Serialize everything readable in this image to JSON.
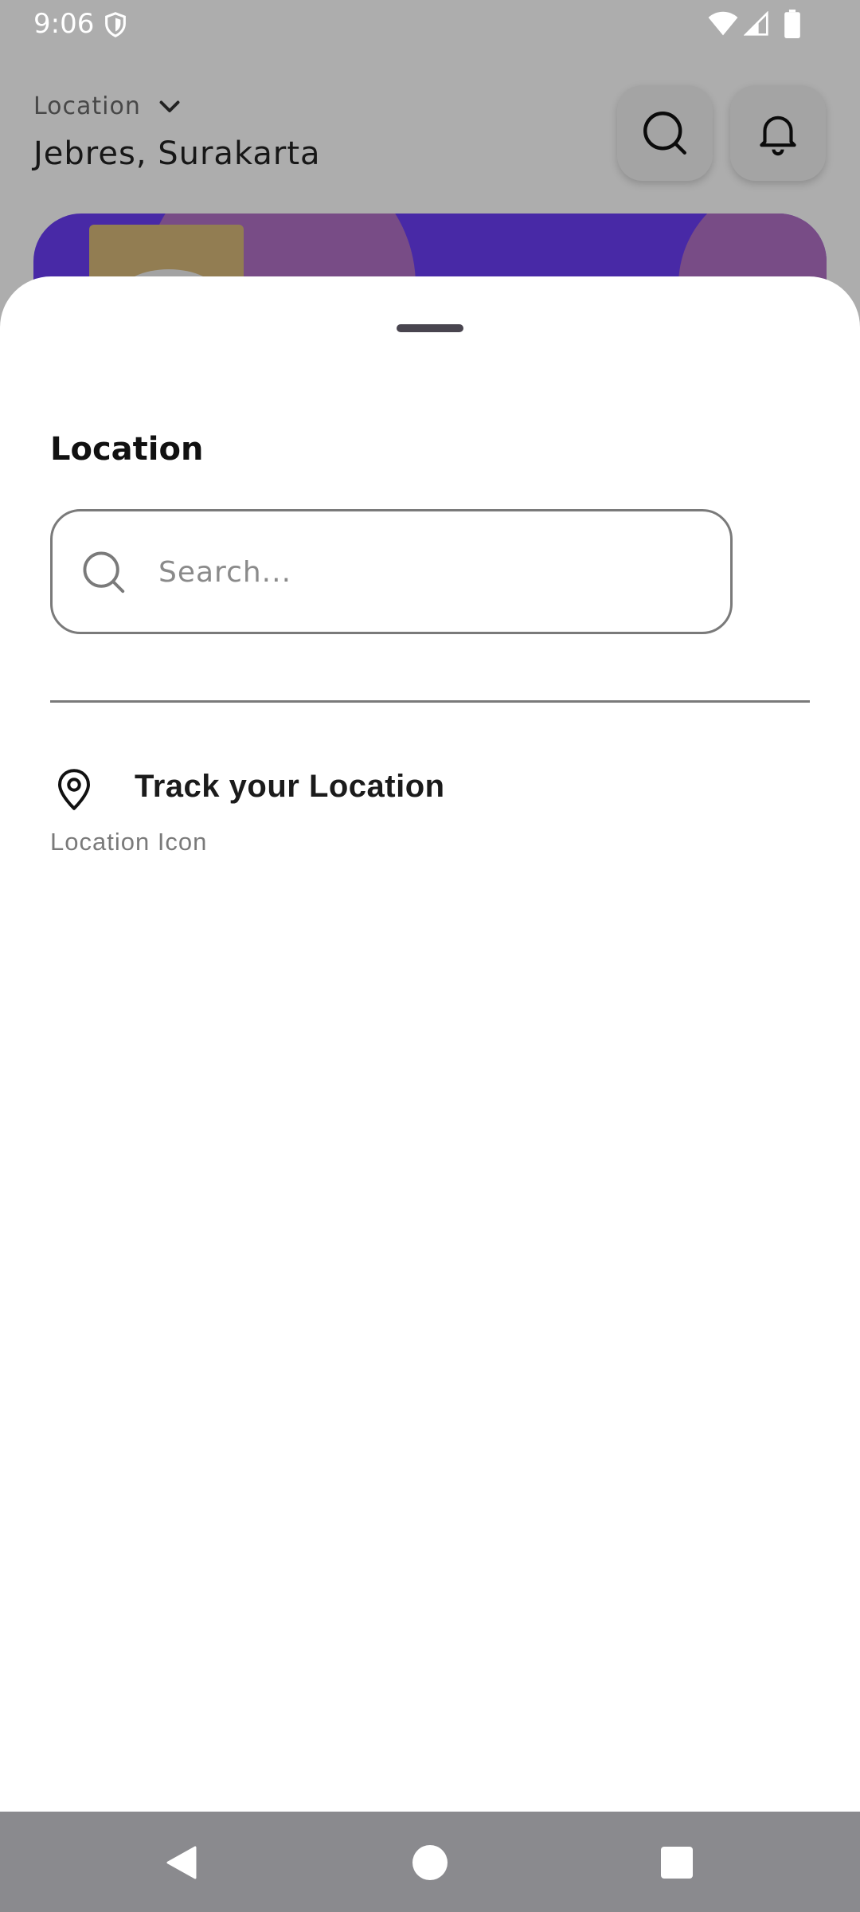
{
  "status_bar": {
    "time": "9:06",
    "icons": [
      "shield-icon",
      "wifi-icon",
      "signal-icon",
      "battery-icon"
    ]
  },
  "header": {
    "location_label": "Location",
    "location_value": "Jebres, Surakarta",
    "icons": [
      "chevron-down-icon",
      "search-icon",
      "bell-icon"
    ]
  },
  "sheet": {
    "title": "Location",
    "search": {
      "placeholder": "Search...",
      "value": ""
    },
    "track_option": {
      "title": "Track your Location",
      "subtitle": "Location Icon",
      "icon": "location-pin-icon"
    }
  },
  "nav_bar": {
    "icons": [
      "back-icon",
      "home-icon",
      "recents-icon"
    ]
  },
  "colors": {
    "scrim": "#000000",
    "banner": "#6a3df5",
    "nav_bar": "#8a8a8e",
    "handle": "#49454f"
  }
}
